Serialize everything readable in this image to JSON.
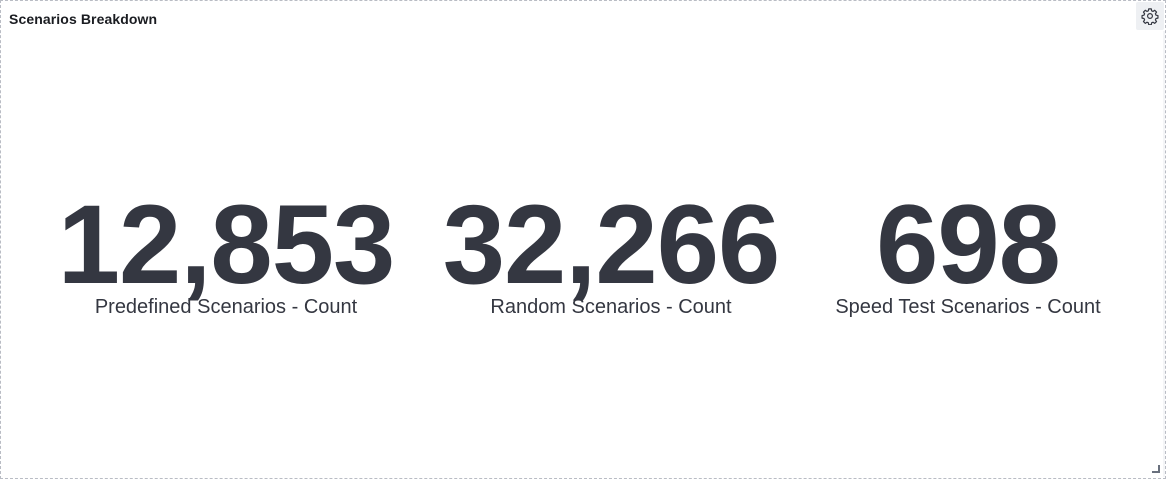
{
  "panel": {
    "title": "Scenarios Breakdown"
  },
  "metrics": [
    {
      "value": "12,853",
      "label": "Predefined Scenarios - Count"
    },
    {
      "value": "32,266",
      "label": "Random Scenarios - Count"
    },
    {
      "value": "698",
      "label": "Speed Test Scenarios - Count"
    }
  ],
  "icons": {
    "settings": "gear-icon",
    "resize": "resize-handle-icon"
  },
  "colors": {
    "metric_text": "#343741",
    "title_text": "#1a1c21",
    "panel_border": "#b9bcc4",
    "gear_bg": "#eef0f3"
  }
}
